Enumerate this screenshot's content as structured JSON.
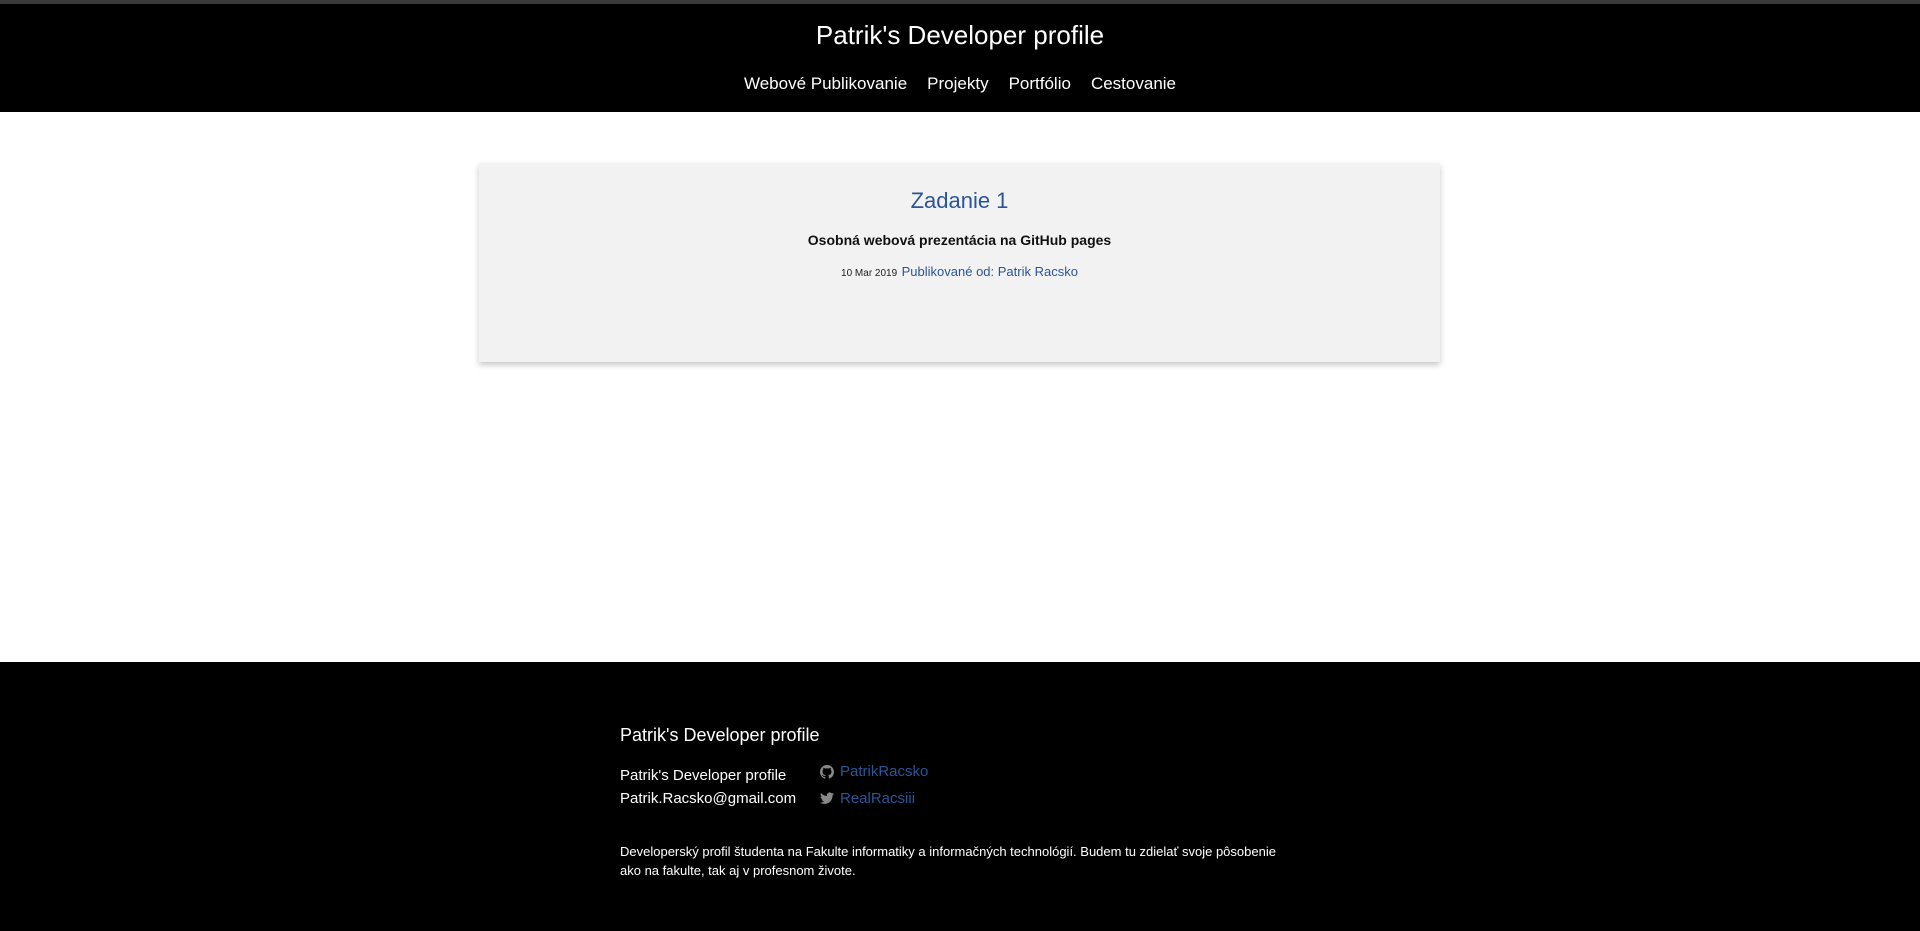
{
  "header": {
    "site_title": "Patrik's Developer profile",
    "nav": [
      {
        "label": "Webové Publikovanie"
      },
      {
        "label": "Projekty"
      },
      {
        "label": "Portfólio"
      },
      {
        "label": "Cestovanie"
      }
    ]
  },
  "post": {
    "title": "Zadanie 1",
    "excerpt": "Osobná webová prezentácia na GitHub pages",
    "date": "10 Mar 2019",
    "author": "Publikované od: Patrik Racsko"
  },
  "footer": {
    "heading": "Patrik's Developer profile",
    "name": "Patrik's Developer profile",
    "email": "Patrik.Racsko@gmail.com",
    "github": {
      "icon": "github-icon",
      "username": "PatrikRacsko"
    },
    "twitter": {
      "icon": "twitter-icon",
      "username": "RealRacsiii"
    },
    "description": "Developerský profil študenta na Fakulte informatiky a informačných technológií. Budem tu zdielať svoje pôsobenie ako na fakulte, tak aj v profesnom živote."
  },
  "colors": {
    "header_bg": "#000000",
    "link": "#2b5597",
    "card_bg": "#f2f2f2",
    "footer_bg": "#000000"
  }
}
